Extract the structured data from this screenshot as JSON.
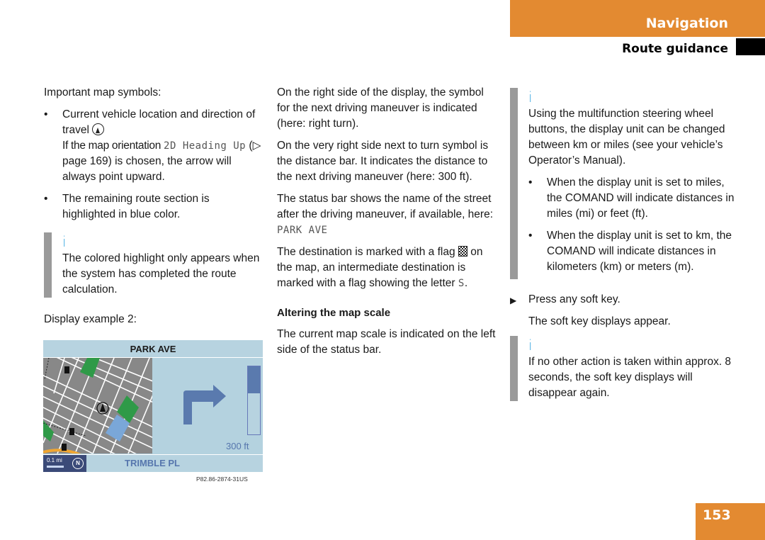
{
  "header": {
    "section": "Navigation",
    "subsection": "Route guidance"
  },
  "page_number": "153",
  "colors": {
    "accent_orange": "#e38a31",
    "info_icon_blue": "#3aa7e0",
    "display_blue": "#5676ad",
    "display_bg": "#b4d2df"
  },
  "col1": {
    "intro": "Important map symbols:",
    "bullet_char": "•",
    "bullet1_line1": "Current vehicle location and direction of travel",
    "bullet1_icon": "vehicle-position-icon",
    "bullet1_pre": "If the map orientation ",
    "bullet1_mono": "2D Heading Up",
    "bullet1_post": " (▷ page 169) is chosen, the arrow will always point upward.",
    "bullet2": "The remaining route section is highlighted in blue color.",
    "info_icon": "i",
    "info_text": "The colored highlight only appears when the system has completed the route calculation.",
    "display_label": "Display example 2:"
  },
  "display": {
    "top_street": "PARK AVE",
    "scale": "0.1 mi",
    "north_symbol": "N",
    "next_street": "TRIMBLE PL",
    "distance": "300 ft",
    "distance_bar_fill": 0.4,
    "maneuver": "right turn",
    "caption_code": "P82.86-2874-31US"
  },
  "col2": {
    "p1": "On the right side of the display, the symbol for the next driving maneuver is indicated (here: right turn).",
    "p2": "On the very right side next to turn symbol is the distance bar. It indicates the distance to the next driving maneuver (here: 300 ft).",
    "p3_pre": "The status bar shows the name of the street after the driving maneuver, if available, here: ",
    "p3_mono": "PARK AVE",
    "p4_pre": "The destination is marked with a flag ",
    "p4_post": " on the map, an intermediate destination is marked with a flag showing the letter ",
    "p4_mono": "S",
    "p4_end": ".",
    "subheading": "Altering the map scale",
    "p5": "The current map scale is indicated on the left side of the status bar."
  },
  "col3": {
    "info1_icon": "i",
    "info1_text": "Using the multifunction steering wheel buttons, the display unit can be changed between km or miles (see your vehicle’s Operator’s Manual).",
    "bullet_char": "•",
    "bullet1": "When the display unit is set to miles, the COMAND will indicate distances in miles (mi) or feet (ft).",
    "bullet2": "When the display unit is set to km, the COMAND will indicate distances in kilometers (km) or meters (m).",
    "step_char": "▶",
    "step": "Press any soft key.",
    "result": "The soft key displays appear.",
    "info2_icon": "i",
    "info2_text": "If no other action is taken within approx. 8 seconds, the soft key displays will disappear again."
  }
}
